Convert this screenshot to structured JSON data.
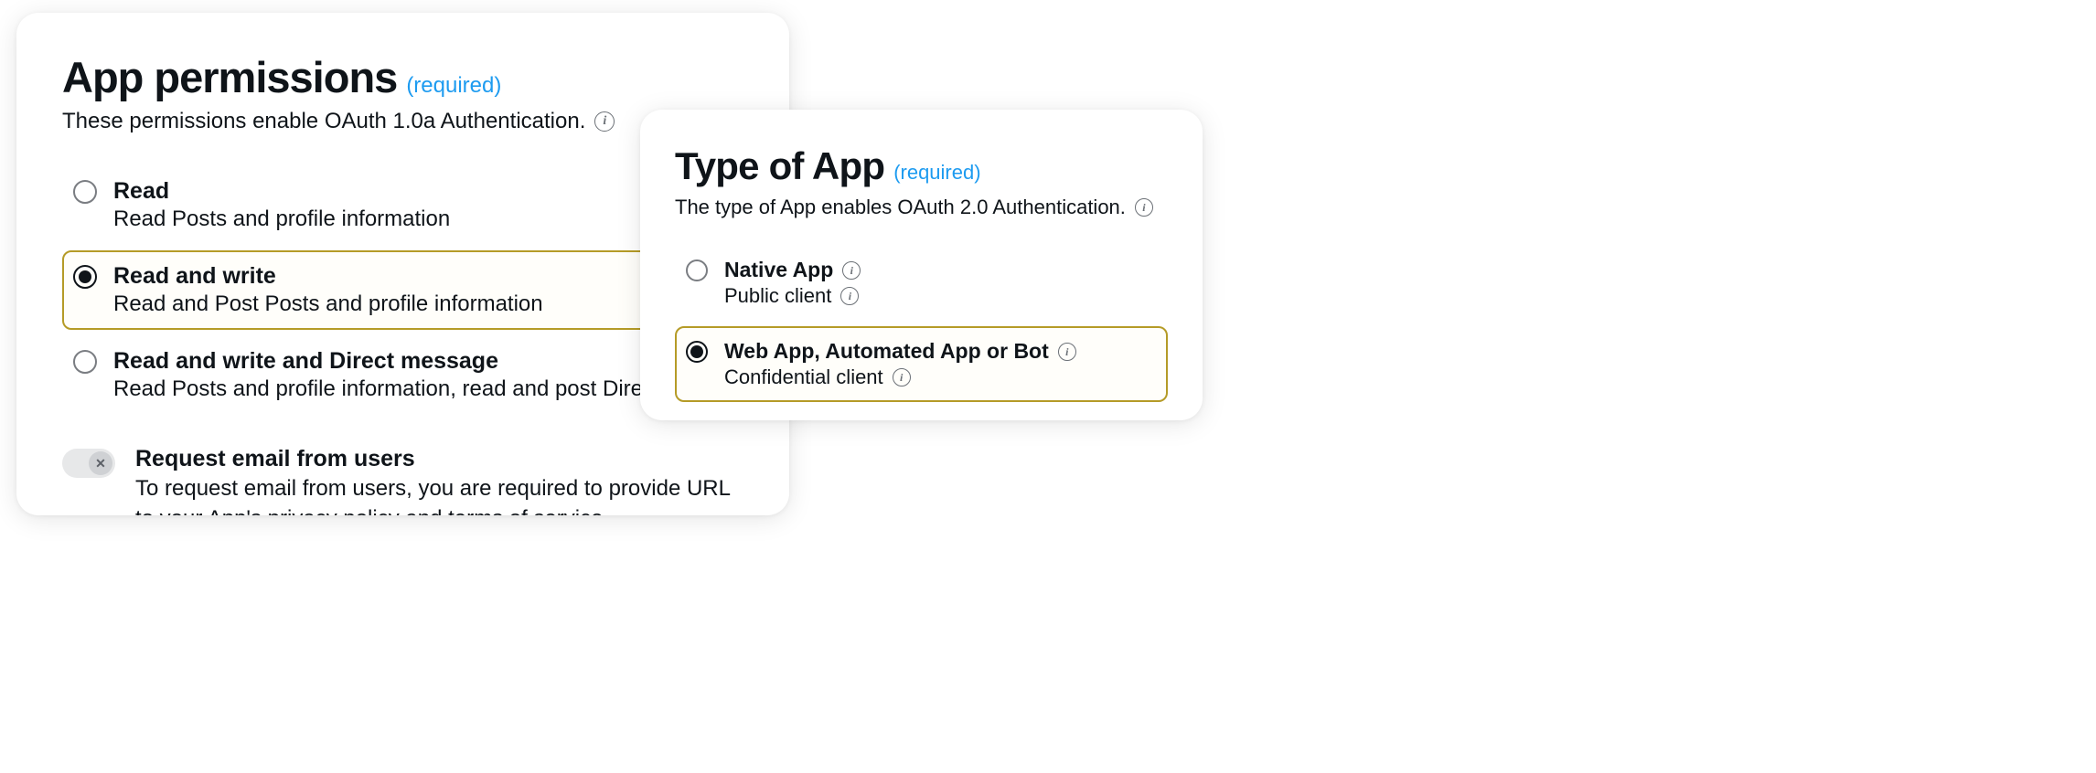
{
  "permissions": {
    "title": "App permissions",
    "required_label": "(required)",
    "subtitle": "These permissions enable OAuth 1.0a Authentication.",
    "options": [
      {
        "label": "Read",
        "description": "Read Posts and profile information",
        "selected": false
      },
      {
        "label": "Read and write",
        "description": "Read and Post Posts and profile information",
        "selected": true
      },
      {
        "label": "Read and write and Direct message",
        "description": "Read Posts and profile information, read and post Direct mes",
        "selected": false
      }
    ],
    "email_toggle": {
      "label": "Request email from users",
      "description": "To request email from users, you are required to provide URL to your App's privacy policy and terms of service.",
      "enabled": false
    }
  },
  "app_type": {
    "title": "Type of App",
    "required_label": "(required)",
    "subtitle": "The type of App enables OAuth 2.0 Authentication.",
    "options": [
      {
        "label": "Native App",
        "description": "Public client",
        "selected": false
      },
      {
        "label": "Web App, Automated App or Bot",
        "description": "Confidential client",
        "selected": true
      }
    ]
  }
}
